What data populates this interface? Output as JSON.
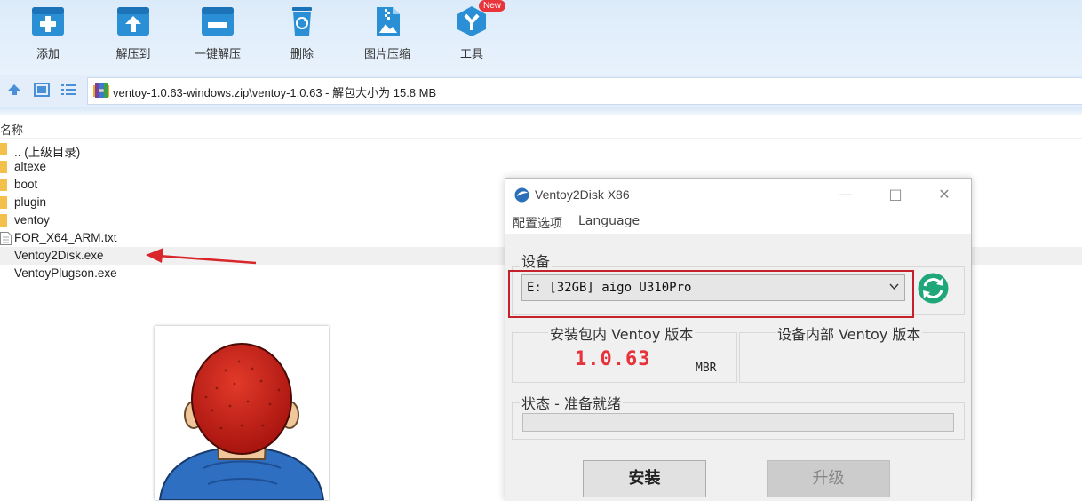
{
  "toolbar": {
    "items": [
      {
        "label": "添加",
        "icon": "add-icon"
      },
      {
        "label": "解压到",
        "icon": "extract-to-icon"
      },
      {
        "label": "一键解压",
        "icon": "one-click-extract-icon"
      },
      {
        "label": "删除",
        "icon": "delete-icon"
      },
      {
        "label": "图片压缩",
        "icon": "image-compress-icon"
      },
      {
        "label": "工具",
        "icon": "tools-icon"
      }
    ],
    "new_badge": "New"
  },
  "address": {
    "path": "ventoy-1.0.63-windows.zip\\ventoy-1.0.63 - 解包大小为 15.8 MB"
  },
  "filelist": {
    "column_name": "名称",
    "items": [
      {
        "name": ".. (上级目录)",
        "type": "folder"
      },
      {
        "name": "altexe",
        "type": "folder"
      },
      {
        "name": "boot",
        "type": "folder"
      },
      {
        "name": "plugin",
        "type": "folder"
      },
      {
        "name": "ventoy",
        "type": "folder"
      },
      {
        "name": "FOR_X64_ARM.txt",
        "type": "text-file"
      },
      {
        "name": "Ventoy2Disk.exe",
        "type": "exe",
        "selected": true
      },
      {
        "name": "VentoyPlugson.exe",
        "type": "exe"
      }
    ]
  },
  "ventoy": {
    "title": "Ventoy2Disk  X86",
    "menu": [
      "配置选项",
      "Language"
    ],
    "device_label": "设备",
    "device_value": "E: [32GB] aigo U310Pro",
    "pkg_version_label": "安装包内 Ventoy 版本",
    "pkg_version": "1.0.63",
    "partition_style": "MBR",
    "dev_version_label": "设备内部 Ventoy 版本",
    "status_label": "状态 - 准备就绪",
    "install_button": "安装",
    "upgrade_button": "升级"
  },
  "colors": {
    "accent": "#2b8fd6",
    "version_red": "#e8323a",
    "highlight_red": "#c4212a",
    "refresh_green": "#1fa679"
  }
}
